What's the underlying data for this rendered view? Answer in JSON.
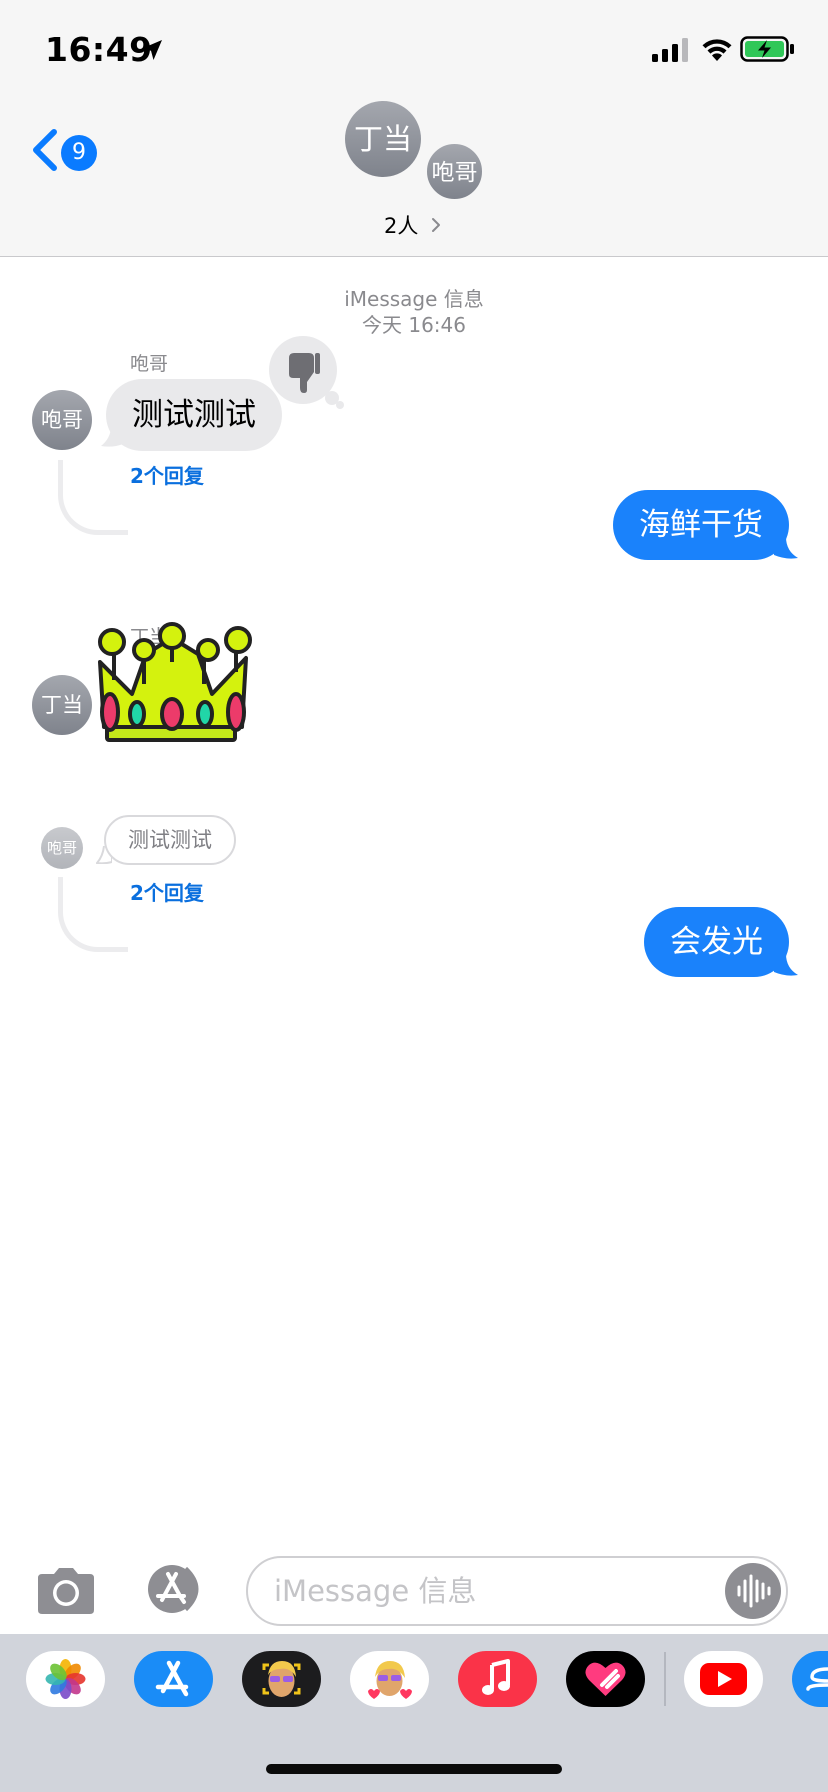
{
  "status_bar": {
    "time": "16:49",
    "icons": [
      "location-arrow-icon",
      "cellular-signal-icon",
      "wifi-icon",
      "battery-charging-icon"
    ]
  },
  "header": {
    "back_count": "9",
    "avatars": [
      {
        "initials": "丁当"
      },
      {
        "initials": "咆哥"
      }
    ],
    "people": "2人"
  },
  "conversation": {
    "service": "iMessage 信息",
    "date": "今天 16:46",
    "messages": [
      {
        "direction": "in",
        "sender": "咆哥",
        "avatar": "咆哥",
        "text": "测试测试",
        "tapback": "thumbs-down-icon",
        "replies": "2个回复"
      },
      {
        "direction": "out",
        "text": "海鲜干货"
      },
      {
        "direction": "in",
        "sender": "丁当",
        "avatar": "丁当",
        "sticker": "crown-sticker"
      },
      {
        "direction": "in",
        "sender": "",
        "avatar": "咆哥",
        "text": "测试测试",
        "replies": "2个回复",
        "faded": true
      },
      {
        "direction": "out",
        "text": "会发光"
      }
    ]
  },
  "input": {
    "placeholder": "iMessage 信息"
  },
  "app_drawer": {
    "apps": [
      "photos-app-icon",
      "app-store-app-icon",
      "memoji-app-icon",
      "memoji-stickers-app-icon",
      "music-app-icon",
      "digital-touch-app-icon",
      "youtube-app-icon",
      "more-app-icon"
    ]
  },
  "colors": {
    "accent_blue": "#0a7bff",
    "outgoing_bubble": "#1a82fb",
    "incoming_bubble": "#e9e9eb",
    "header_bg": "#f6f6f6",
    "drawer_bg": "#d1d4db"
  }
}
